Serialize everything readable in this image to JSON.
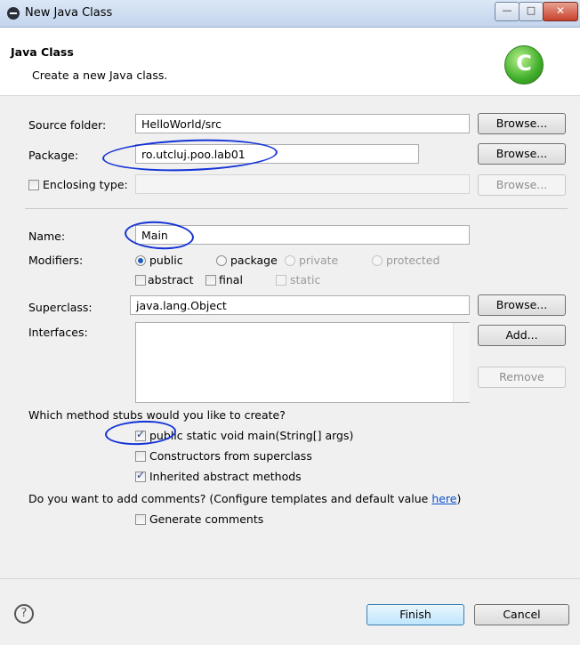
{
  "window": {
    "title": "New Java Class",
    "minimize_glyph": "—",
    "maximize_glyph": "□",
    "close_glyph": "✕"
  },
  "header": {
    "title": "Java Class",
    "description": "Create a new Java class.",
    "icon_letter": "C",
    "icon": "class-wizard-icon"
  },
  "source_folder": {
    "label": "Source folder:",
    "value": "HelloWorld/src",
    "browse": "Browse..."
  },
  "package": {
    "label": "Package:",
    "value": "ro.utcluj.poo.lab01",
    "browse": "Browse..."
  },
  "enclosing": {
    "label": "Enclosing type:",
    "value": "",
    "browse": "Browse...",
    "checked": false
  },
  "name": {
    "label": "Name:",
    "value": "Main"
  },
  "modifiers": {
    "label": "Modifiers:",
    "public": "public",
    "package": "package",
    "private": "private",
    "protected": "protected",
    "abstract": "abstract",
    "final": "final",
    "static": "static",
    "selected": "public"
  },
  "superclass": {
    "label": "Superclass:",
    "value": "java.lang.Object",
    "browse": "Browse..."
  },
  "interfaces": {
    "label": "Interfaces:",
    "add": "Add...",
    "remove": "Remove"
  },
  "stubs": {
    "question": "Which method stubs would you like to create?",
    "main": "public static void main(String[] args)",
    "constructors": "Constructors from superclass",
    "inherited": "Inherited abstract methods"
  },
  "comments": {
    "question_prefix": "Do you want to add comments? (Configure templates and default value ",
    "link": "here",
    "question_suffix": ")",
    "generate": "Generate comments"
  },
  "footer": {
    "help_glyph": "?",
    "finish": "Finish",
    "cancel": "Cancel"
  },
  "annotation_color": "#1433d6"
}
